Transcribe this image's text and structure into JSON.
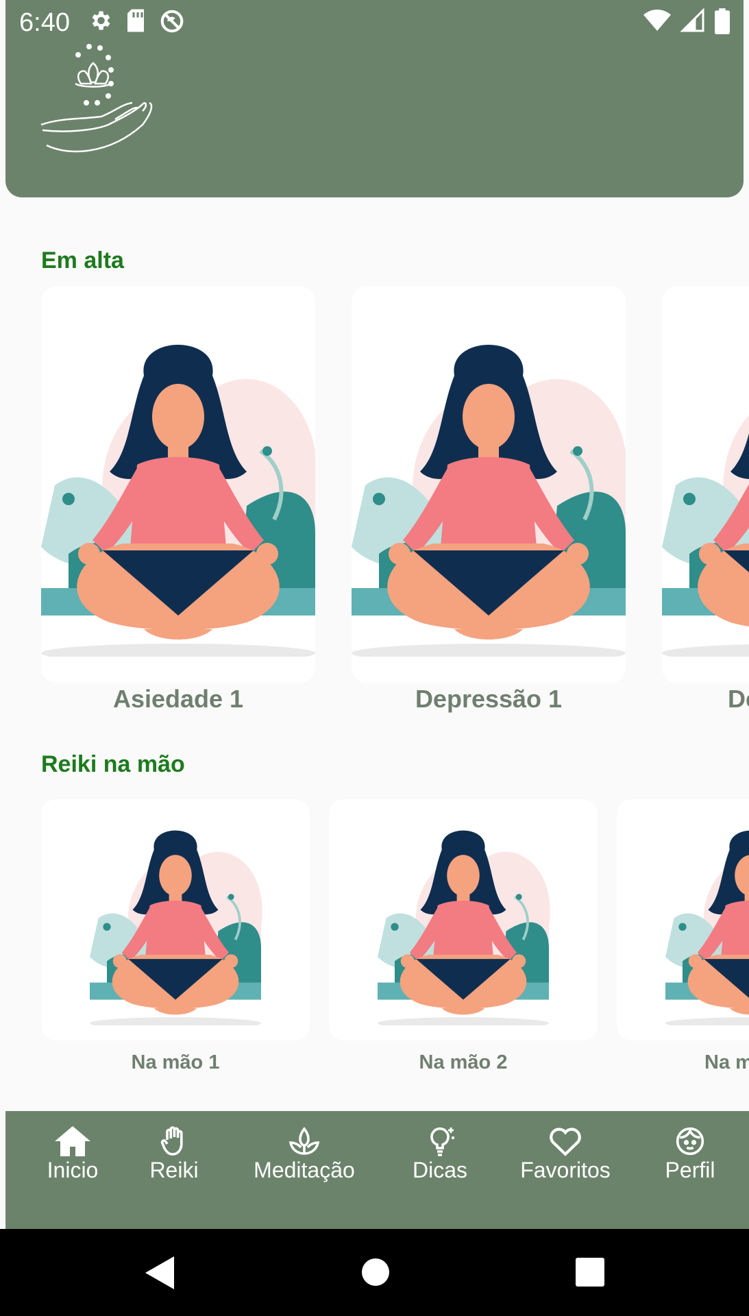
{
  "status_bar": {
    "time": "6:40",
    "left_icons": [
      "gear-icon",
      "sd-card-icon",
      "no-data-icon"
    ],
    "right_icons": [
      "wifi-icon",
      "signal-icon",
      "battery-icon"
    ]
  },
  "header": {
    "background_color": "#6b836b",
    "logo_icon": "lotus-hand-icon"
  },
  "sections": [
    {
      "title": "Em alta",
      "cards": [
        {
          "label": "Asiedade 1"
        },
        {
          "label": "Depressão 1"
        },
        {
          "label": "De"
        }
      ]
    },
    {
      "title": "Reiki na mão",
      "cards": [
        {
          "label": "Na mão 1"
        },
        {
          "label": "Na mão 2"
        },
        {
          "label": "Na m"
        }
      ]
    }
  ],
  "bottom_nav": {
    "items": [
      {
        "label": "Inicio",
        "icon": "home-icon"
      },
      {
        "label": "Reiki",
        "icon": "hand-icon"
      },
      {
        "label": "Meditação",
        "icon": "lotus-icon"
      },
      {
        "label": "Dicas",
        "icon": "lightbulb-icon"
      },
      {
        "label": "Favoritos",
        "icon": "heart-icon"
      },
      {
        "label": "Perfil",
        "icon": "face-icon"
      }
    ]
  },
  "system_nav": [
    "back-icon",
    "home-circle-icon",
    "recents-icon"
  ],
  "colors": {
    "accent_green": "#6b836b",
    "section_title": "#1d7a1d",
    "card_label": "#6f7f6f"
  }
}
